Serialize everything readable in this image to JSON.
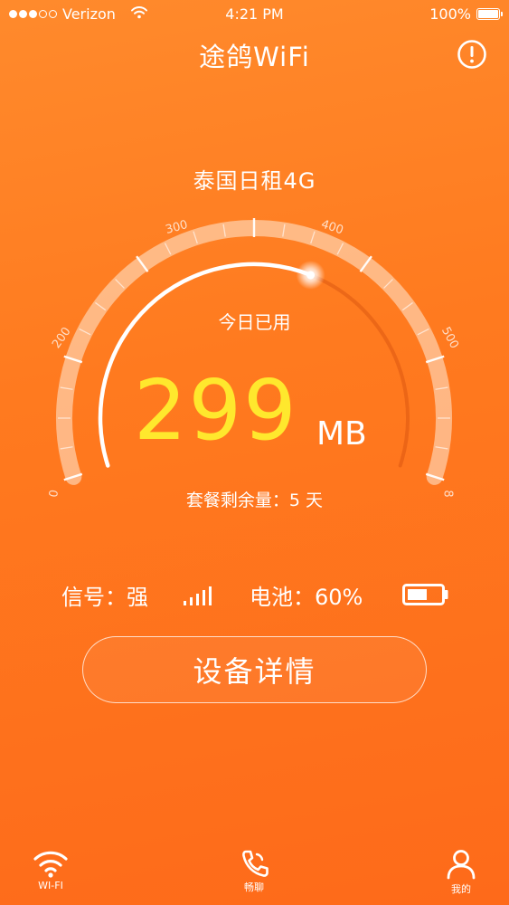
{
  "status_bar": {
    "carrier": "Verizon",
    "time": "4:21 PM",
    "battery": "100%"
  },
  "header": {
    "title": "途鸽WiFi",
    "info_icon": "info-circle-icon"
  },
  "plan": {
    "name": "泰国日租4G"
  },
  "gauge": {
    "tick_labels": [
      "0",
      "200",
      "300",
      "400",
      "500",
      "8"
    ],
    "used_label": "今日已用",
    "used_value": "299",
    "used_unit": "MB",
    "remaining": "套餐剩余量：5 天",
    "progress_fraction": 0.6
  },
  "stats": {
    "signal": "信号：强",
    "battery": "电池：60%",
    "battery_level": 0.6
  },
  "detail_button": {
    "label": "设备详情"
  },
  "tabbar": {
    "items": [
      {
        "label": "WI-FI",
        "icon": "wifi-icon"
      },
      {
        "label": "畅聊",
        "icon": "phone-icon"
      },
      {
        "label": "我的",
        "icon": "user-icon"
      }
    ]
  },
  "colors": {
    "accent": "#ffe82d",
    "background_top": "#ff8a2c",
    "background_bottom": "#fe6a1a"
  }
}
